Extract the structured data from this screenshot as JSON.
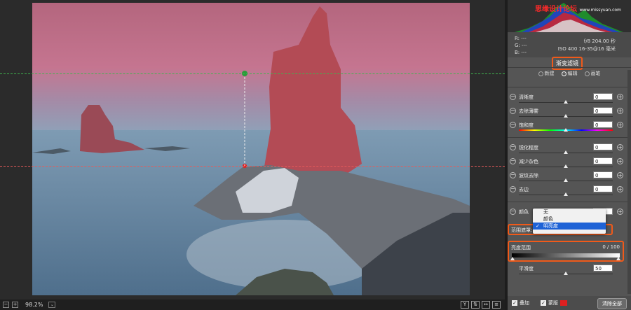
{
  "colors": {
    "accent_highlight": "#f05a1a",
    "selection": "#1e62d6",
    "mask_red": "#e02020"
  },
  "watermark": {
    "main": "思缘设计论坛",
    "sub": "www.missyuan.com"
  },
  "info": {
    "r": "R:  ---",
    "g": "G:  ---",
    "b": "B:  ---",
    "aperture_shutter": "f/8   204.00 秒",
    "iso_lens": "ISO 400   16-35@16 毫米"
  },
  "tool_title": "渐变滤镜",
  "modes": {
    "new": "新建",
    "edit": "编辑",
    "brush": "画笔"
  },
  "sliders_group1": [
    {
      "label": "清晰度",
      "value": "0"
    },
    {
      "label": "去除薄雾",
      "value": "0"
    },
    {
      "label": "饱和度",
      "value": "0"
    }
  ],
  "sliders_group2": [
    {
      "label": "锐化程度",
      "value": "0"
    },
    {
      "label": "减少杂色",
      "value": "0"
    },
    {
      "label": "波纹去除",
      "value": "0"
    },
    {
      "label": "去边",
      "value": "0"
    }
  ],
  "color_label": "颜色",
  "mask": {
    "label": "范围遮罩:",
    "options": [
      "无",
      "颜色",
      "明亮度"
    ],
    "selected": "明亮度"
  },
  "luminance": {
    "label": "亮度范围",
    "value": "0 / 100"
  },
  "smoothness": {
    "label": "平滑度",
    "value": "50"
  },
  "footer": {
    "overlay": "叠加",
    "mask": "蒙版",
    "clear": "清除全部"
  },
  "status": {
    "zoom": "98.2%"
  }
}
